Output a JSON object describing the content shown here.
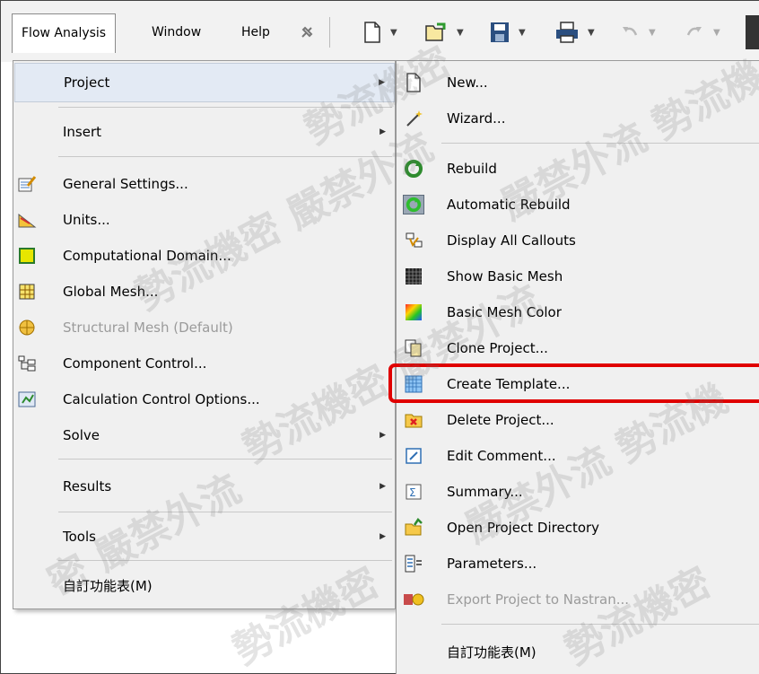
{
  "menubar": {
    "items": [
      "Flow Analysis",
      "Window",
      "Help"
    ],
    "toolbar_icons": [
      "new-document-icon",
      "open-folder-icon",
      "save-icon",
      "print-icon",
      "undo-icon",
      "redo-icon"
    ]
  },
  "dropdown": {
    "items": [
      {
        "label": "Project",
        "submenu": true,
        "icon": null
      },
      {
        "label": "Insert",
        "submenu": true,
        "icon": null
      },
      {
        "label": "General Settings...",
        "icon": "general-settings-icon"
      },
      {
        "label": "Units...",
        "icon": "units-icon"
      },
      {
        "label": "Computational Domain...",
        "icon": "computational-domain-icon"
      },
      {
        "label": "Global Mesh...",
        "icon": "global-mesh-icon"
      },
      {
        "label": "Structural Mesh (Default)",
        "icon": "structural-mesh-icon",
        "disabled": true
      },
      {
        "label": "Component Control...",
        "icon": "component-control-icon"
      },
      {
        "label": "Calculation Control Options...",
        "icon": "calculation-control-icon"
      },
      {
        "label": "Solve",
        "submenu": true
      },
      {
        "label": "Results",
        "submenu": true
      },
      {
        "label": "Tools",
        "submenu": true
      },
      {
        "label": "自訂功能表(M)"
      }
    ]
  },
  "submenu": {
    "items": [
      {
        "label": "New...",
        "icon": "new-icon"
      },
      {
        "label": "Wizard...",
        "icon": "wizard-icon"
      },
      {
        "label": "Rebuild",
        "icon": "rebuild-icon"
      },
      {
        "label": "Automatic Rebuild",
        "icon": "automatic-rebuild-icon"
      },
      {
        "label": "Display All Callouts",
        "icon": "callouts-icon"
      },
      {
        "label": "Show Basic Mesh",
        "icon": "basic-mesh-icon"
      },
      {
        "label": "Basic Mesh Color",
        "icon": "mesh-color-icon"
      },
      {
        "label": "Clone Project...",
        "icon": "clone-icon"
      },
      {
        "label": "Create Template...",
        "icon": "template-icon",
        "highlighted": true
      },
      {
        "label": "Delete Project...",
        "icon": "delete-icon"
      },
      {
        "label": "Edit Comment...",
        "icon": "comment-icon"
      },
      {
        "label": "Summary...",
        "icon": "summary-icon"
      },
      {
        "label": "Open Project Directory",
        "icon": "open-directory-icon"
      },
      {
        "label": "Parameters...",
        "icon": "parameters-icon"
      },
      {
        "label": "Export Project to Nastran...",
        "icon": "nastran-icon",
        "disabled": true
      },
      {
        "label": "自訂功能表(M)"
      }
    ]
  },
  "colors": {
    "highlight": "#e00000",
    "menu_bg": "#f0f0f0",
    "hover": "#e3eaf4"
  }
}
